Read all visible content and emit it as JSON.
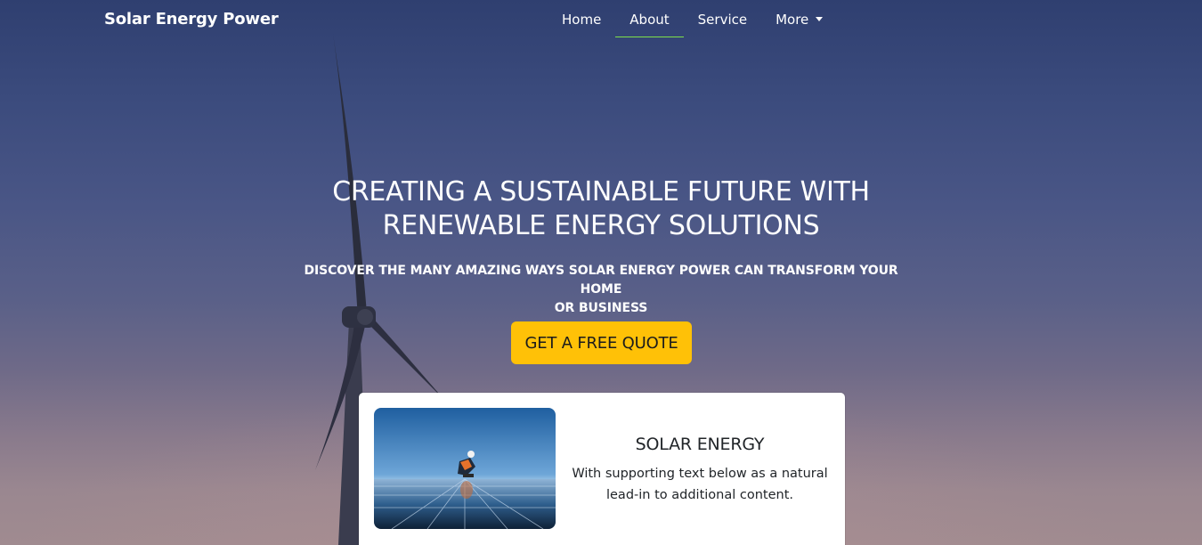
{
  "navbar": {
    "brand": "Solar Energy Power",
    "links": [
      {
        "label": "Home"
      },
      {
        "label": "About"
      },
      {
        "label": "Service"
      },
      {
        "label": "More"
      }
    ]
  },
  "hero": {
    "headline_line1": "CREATING A SUSTAINABLE FUTURE WITH",
    "headline_line2": "RENEWABLE ENERGY SOLUTIONS",
    "subheadline_line1": "DISCOVER THE MANY AMAZING WAYS SOLAR ENERGY POWER CAN TRANSFORM YOUR HOME",
    "subheadline_line2": "OR BUSINESS",
    "cta_label": "GET A FREE QUOTE"
  },
  "card": {
    "title": "SOLAR ENERGY",
    "text_line1": "With supporting text below as a natural",
    "text_line2": "lead-in to additional content."
  },
  "colors": {
    "accent_button": "#ffc107",
    "active_underline": "#7ee04a",
    "hero_sky": "#3b4b7d"
  },
  "icons": {
    "dropdown": "caret-down-icon"
  }
}
